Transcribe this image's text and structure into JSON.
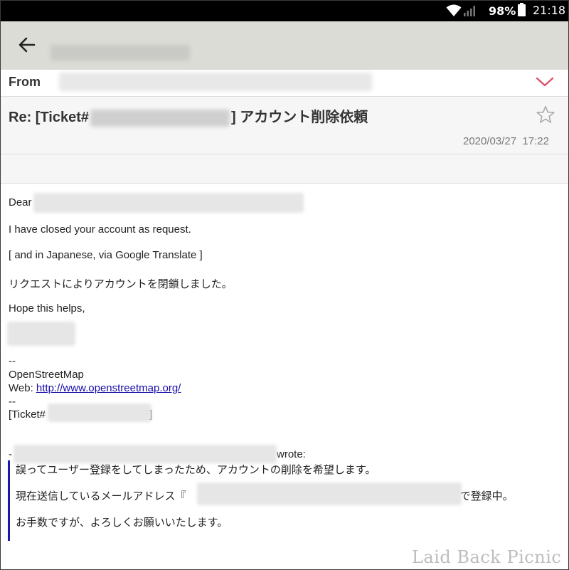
{
  "status_bar": {
    "battery_percent": "98%",
    "time": "21:18",
    "icons": [
      "wifi-icon",
      "signal-icon",
      "battery-icon"
    ]
  },
  "header": {
    "icons": [
      "back-arrow-icon"
    ]
  },
  "message": {
    "from_label": "From",
    "subject_prefix": "Re: [Ticket#",
    "subject_suffix": "] アカウント削除依頼",
    "date": "2020/03/27",
    "time": "17:22",
    "icons": [
      "chevron-down-icon",
      "star-icon"
    ]
  },
  "body": {
    "greeting": "Dear",
    "line1": "I have closed your account as request.",
    "line2": "[ and in Japanese, via Google Translate ]",
    "line3": "リクエストによりアカウントを閉鎖しました。",
    "line4": "Hope this helps,",
    "sig_dashes": "--",
    "org_name": "OpenStreetMap",
    "web_label": "Web: ",
    "web_url": "http://www.openstreetmap.org/",
    "sig_dashes2": "--",
    "ticket_prefix": "[Ticket#",
    "ticket_suffix": "]",
    "wrote_prefix": "-",
    "wrote_suffix": "wrote:"
  },
  "quoted": {
    "line1": "誤ってユーザー登録をしてしまったため、アカウントの削除を希望します。",
    "line2_prefix": "現在送信しているメールアドレス『",
    "line2_suffix": "』で登録中。",
    "line3": "お手数ですが、よろしくお願いいたします。"
  },
  "watermark": "Laid Back Picnic",
  "colors": {
    "status_bar": "#000000",
    "app_bar": "#dcdcd6",
    "link": "#1a0dab",
    "quote_bar": "#1a1aa8",
    "chevron": "#e0506a"
  }
}
